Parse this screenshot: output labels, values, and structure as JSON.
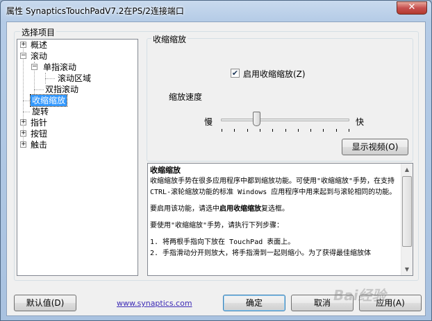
{
  "window": {
    "title": "属性 SynapticsTouchPadV7.2在PS/2连接端口",
    "close_glyph": "✕"
  },
  "select_group": {
    "legend": "选择项目",
    "tree": {
      "overview": "概述",
      "scroll": "滚动",
      "single_finger_scroll": "单指滚动",
      "scroll_area": "滚动区域",
      "two_finger_scroll": "双指滚动",
      "pinch_zoom": "收缩缩放",
      "rotate": "旋转",
      "pointing": "指针",
      "buttons": "按钮",
      "tap": "触击",
      "plus": "+",
      "minus": "−"
    }
  },
  "pinch_group": {
    "legend": "收缩缩放",
    "enable_checkbox_label": "启用收缩缩放(Z)",
    "enable_checked": true,
    "check_glyph": "✔",
    "speed_label": "缩放速度",
    "slider_min_label": "慢",
    "slider_max_label": "快",
    "slider_value": 0.28,
    "tick_count": 11,
    "show_video_button": "显示视频(O)"
  },
  "help": {
    "title": "收缩缩放",
    "para1": "收缩缩放手势在很多应用程序中都到缩放功能。可使用\"收缩缩放\"手势，在支持 CTRL-滚轮缩放功能的标准 Windows 应用程序中用来起到与滚轮相同的功能。",
    "para2_pre": "要启用该功能，请选中",
    "para2_bold": "启用收缩缩放",
    "para2_post": "复选框。",
    "para3": "要使用\"收缩缩放\"手势，请执行下列步骤：",
    "step1": "1. 将两根手指向下放在 TouchPad 表面上。",
    "step2": "2. 手指滑动分开则放大，将手指滑到一起则缩小。为了获得最佳缩放体",
    "scroll_up": "▲",
    "scroll_down": "▼"
  },
  "footer": {
    "defaults_button": "默认值(D)",
    "link": "www.synaptics.com",
    "ok_button": "确定",
    "cancel_button": "取消",
    "apply_button": "应用(A)",
    "watermark": "Bai经验"
  }
}
